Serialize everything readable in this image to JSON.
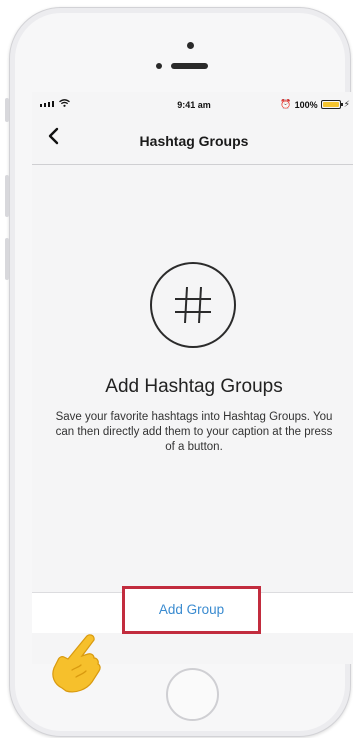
{
  "status_bar": {
    "time": "9:41 am",
    "battery_percent": "100%",
    "battery_color": "#f4c430",
    "icons": [
      "signal-icon",
      "wifi-icon",
      "alarm-icon",
      "battery-icon",
      "charging-icon"
    ]
  },
  "nav": {
    "title": "Hashtag Groups",
    "back_icon": "chevron-left-icon"
  },
  "empty_state": {
    "icon": "hashtag-icon",
    "title": "Add Hashtag Groups",
    "description": "Save your favorite hashtags into Hashtag Groups. You can then directly add them to your caption at the press of a button."
  },
  "bottom_bar": {
    "add_group_label": "Add Group",
    "link_color": "#3a8bd0",
    "highlight_color": "#c22c3e"
  },
  "overlay": {
    "pointer_icon": "pointing-hand-icon"
  }
}
